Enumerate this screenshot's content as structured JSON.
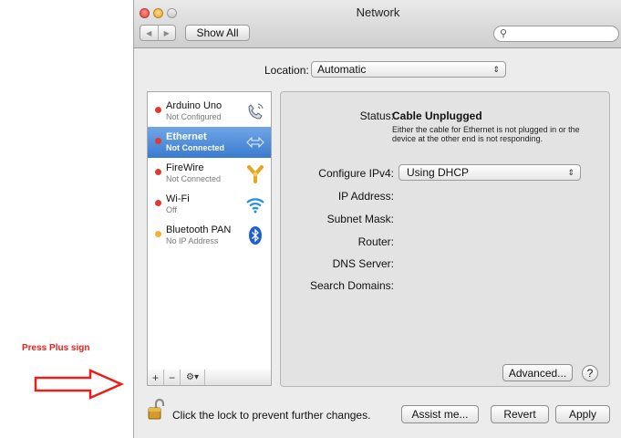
{
  "annotation": {
    "text": "Press Plus sign",
    "color": "#e8201a"
  },
  "window": {
    "title": "Network",
    "show_all": "Show All",
    "search_placeholder": ""
  },
  "location": {
    "label": "Location:",
    "value": "Automatic"
  },
  "services": [
    {
      "name": "Arduino Uno",
      "status": "Not Configured",
      "dot": "#e0392f",
      "icon": "phone-icon",
      "selected": false
    },
    {
      "name": "Ethernet",
      "status": "Not Connected",
      "dot": "#e0392f",
      "icon": "ethernet-arrows-icon",
      "selected": true
    },
    {
      "name": "FireWire",
      "status": "Not Connected",
      "dot": "#e0392f",
      "icon": "firewire-icon",
      "selected": false
    },
    {
      "name": "Wi-Fi",
      "status": "Off",
      "dot": "#e0392f",
      "icon": "wifi-icon",
      "selected": false
    },
    {
      "name": "Bluetooth PAN",
      "status": "No IP Address",
      "dot": "#f2b233",
      "icon": "bluetooth-icon",
      "selected": false
    }
  ],
  "sidebar_controls": {
    "add": "+",
    "remove": "−",
    "gear": "⚙▾"
  },
  "detail": {
    "status_label": "Status:",
    "status_value": "Cable Unplugged",
    "status_note": "Either the cable for Ethernet is not plugged in or the device at the other end is not responding.",
    "ipv4_label": "Configure IPv4:",
    "ipv4_value": "Using DHCP",
    "ip_label": "IP Address:",
    "subnet_label": "Subnet Mask:",
    "router_label": "Router:",
    "dns_label": "DNS Server:",
    "search_domains_label": "Search Domains:",
    "advanced": "Advanced...",
    "help": "?"
  },
  "footer": {
    "lock_text": "Click the lock to prevent further changes.",
    "assist": "Assist me...",
    "revert": "Revert",
    "apply": "Apply"
  },
  "colors": {
    "selection": "#3b7ad0",
    "red_status": "#e0392f",
    "yellow_status": "#f2b233"
  }
}
